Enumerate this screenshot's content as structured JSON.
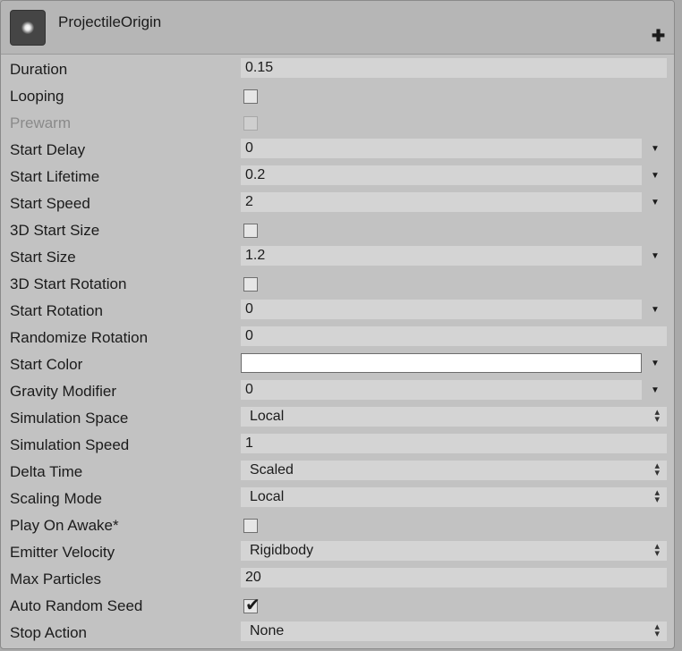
{
  "component": {
    "title": "ProjectileOrigin",
    "icon": "particle-system-icon",
    "add_icon": "plus-icon"
  },
  "fields": {
    "duration": {
      "label": "Duration",
      "value": "0.15"
    },
    "looping": {
      "label": "Looping",
      "checked": false
    },
    "prewarm": {
      "label": "Prewarm",
      "checked": false,
      "disabled": true
    },
    "start_delay": {
      "label": "Start Delay",
      "value": "0"
    },
    "start_lifetime": {
      "label": "Start Lifetime",
      "value": "0.2"
    },
    "start_speed": {
      "label": "Start Speed",
      "value": "2"
    },
    "start_size_3d": {
      "label": "3D Start Size",
      "checked": false
    },
    "start_size": {
      "label": "Start Size",
      "value": "1.2"
    },
    "start_rotation_3d": {
      "label": "3D Start Rotation",
      "checked": false
    },
    "start_rotation": {
      "label": "Start Rotation",
      "value": "0"
    },
    "randomize_rotation": {
      "label": "Randomize Rotation",
      "value": "0"
    },
    "start_color": {
      "label": "Start Color",
      "value": "#ffffff"
    },
    "gravity_modifier": {
      "label": "Gravity Modifier",
      "value": "0"
    },
    "simulation_space": {
      "label": "Simulation Space",
      "value": "Local"
    },
    "simulation_speed": {
      "label": "Simulation Speed",
      "value": "1"
    },
    "delta_time": {
      "label": "Delta Time",
      "value": "Scaled"
    },
    "scaling_mode": {
      "label": "Scaling Mode",
      "value": "Local"
    },
    "play_on_awake": {
      "label": "Play On Awake*",
      "checked": false
    },
    "emitter_velocity": {
      "label": "Emitter Velocity",
      "value": "Rigidbody"
    },
    "max_particles": {
      "label": "Max Particles",
      "value": "20"
    },
    "auto_random_seed": {
      "label": "Auto Random Seed",
      "checked": true
    },
    "stop_action": {
      "label": "Stop Action",
      "value": "None"
    }
  },
  "glyphs": {
    "curve_arrow": "▼",
    "updown": "▲▼",
    "check": "✔",
    "plus": "✚"
  }
}
